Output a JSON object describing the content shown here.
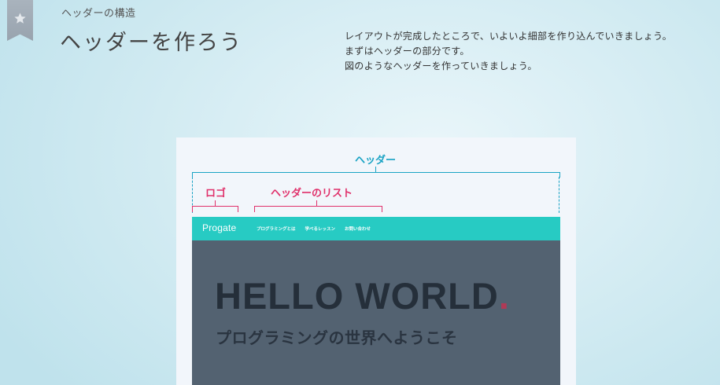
{
  "lesson": {
    "subtitle": "ヘッダーの構造",
    "title": "ヘッダーを作ろう",
    "description": [
      "レイアウトが完成したところで、いよいよ細部を作り込んでいきましょう。",
      "まずはヘッダーの部分です。",
      "図のようなヘッダーを作っていきましょう。"
    ]
  },
  "figure": {
    "annotations": {
      "header": "ヘッダー",
      "logo": "ロゴ",
      "header_list": "ヘッダーのリスト"
    },
    "site": {
      "logo": "Progate",
      "nav": [
        "プログラミングとは",
        "学べるレッスン",
        "お問い合わせ"
      ],
      "hero_title": "HELLO WORLD",
      "hero_dot": ".",
      "hero_subtitle": "プログラミングの世界へようこそ"
    }
  },
  "colors": {
    "accent_blue": "#1aa3c4",
    "accent_pink": "#e0316b",
    "header_bg": "#27cbc3",
    "hero_bg": "#536271",
    "hero_dot": "#b03a56"
  },
  "icons": [
    "star-bookmark-icon"
  ]
}
